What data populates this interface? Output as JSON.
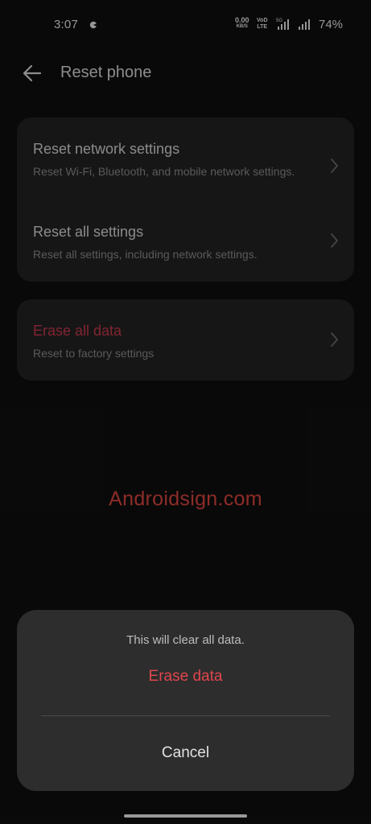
{
  "status_bar": {
    "time": "3:07",
    "net_speed": "0.00",
    "net_unit": "KB/S",
    "volte_top": "Vo",
    "volte_bottom": "LTE",
    "volte_mark": "D",
    "network_type": "5G",
    "battery": "74%"
  },
  "header": {
    "title": "Reset phone",
    "back_icon": "arrow-left-icon"
  },
  "settings": [
    {
      "title": "Reset network settings",
      "subtitle": "Reset Wi-Fi, Bluetooth, and mobile network settings."
    },
    {
      "title": "Reset all settings",
      "subtitle": "Reset all settings, including network settings."
    },
    {
      "title": "Erase all data",
      "subtitle": "Reset to factory settings",
      "title_color": "#c8384c"
    }
  ],
  "watermark": "Androidsign.com",
  "dialog": {
    "message": "This will clear all data.",
    "confirm_label": "Erase data",
    "cancel_label": "Cancel",
    "confirm_color": "#e0464d"
  },
  "colors": {
    "background": "#0f0f0f",
    "card": "#232323",
    "dialog": "#2d2d2d",
    "danger": "#c8384c"
  }
}
